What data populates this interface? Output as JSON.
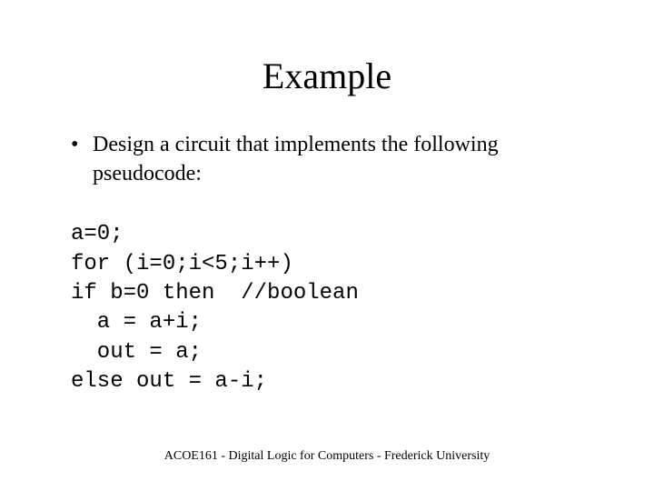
{
  "title": "Example",
  "bullet_marker": "•",
  "bullet_text": "Design a circuit that implements the following pseudocode:",
  "code_line1": "a=0;",
  "code_line2": "for (i=0;i<5;i++)",
  "code_line3": "if b=0 then  //boolean",
  "code_line4": "  a = a+i;",
  "code_line5": "  out = a;",
  "code_line6": "else out = a-i;",
  "footer": "ACOE161 - Digital Logic for Computers - Frederick University"
}
